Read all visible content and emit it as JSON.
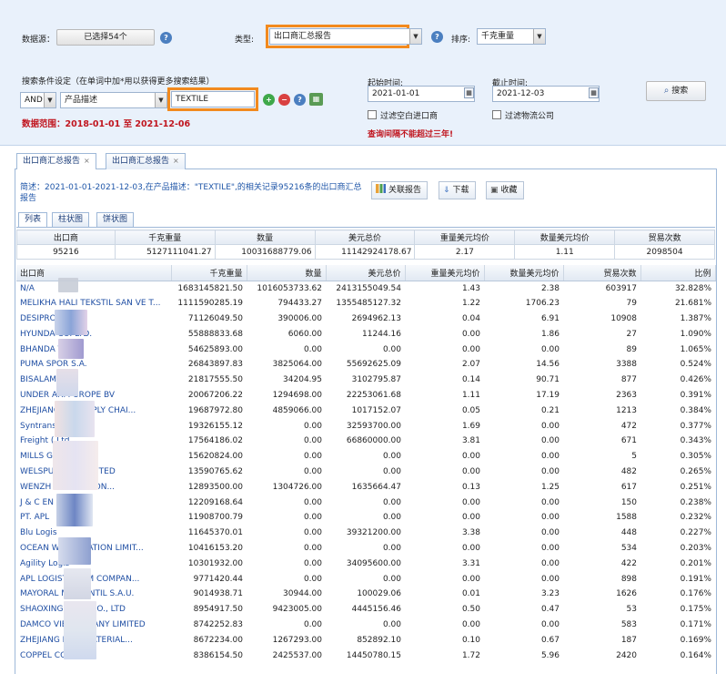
{
  "filters": {
    "datasource_label": "数据源：",
    "datasource_value": "已选择54个",
    "type_label": "类型:",
    "type_value": "出口商汇总报告",
    "sort_label": "排序:",
    "sort_value": "千克重量",
    "condition_label": "搜索条件设定（在单词中加*用以获得更多搜索结果）",
    "logic_value": "AND",
    "field_value": "产品描述",
    "keyword_value": "TEXTILE",
    "range_text": "数据范围：2018-01-01 至 2021-12-06",
    "start_label": "起始时间:",
    "start_value": "2021-01-01",
    "end_label": "截止时间:",
    "end_value": "2021-12-03",
    "filter_empty_label": "过滤空白进口商",
    "filter_logistics_label": "过滤物流公司",
    "warn_text": "查询间隔不能超过三年!",
    "search_label": "搜索"
  },
  "tabs": [
    {
      "label": "出口商汇总报告"
    },
    {
      "label": "出口商汇总报告"
    }
  ],
  "summary": {
    "text": "简述：2021-01-01-2021-12-03,在产品描述：\"TEXTILE\",的相关记录95216条的出口商汇总报告",
    "related_label": "关联报告",
    "download_label": "下载",
    "save_label": "收藏"
  },
  "view_tabs": [
    {
      "label": "列表"
    },
    {
      "label": "柱状图"
    },
    {
      "label": "饼状图"
    }
  ],
  "summary_table": {
    "headers": [
      "出口商",
      "千克重量",
      "数量",
      "美元总价",
      "重量美元均价",
      "数量美元均价",
      "贸易次数"
    ],
    "values": [
      "95216",
      "5127111041.27",
      "10031688779.06",
      "11142924178.67",
      "2.17",
      "1.11",
      "2098504"
    ]
  },
  "table": {
    "headers": [
      "出口商",
      "千克重量",
      "数量",
      "美元总价",
      "重量美元均价",
      "数量美元均价",
      "贸易次数",
      "比例"
    ],
    "rows": [
      [
        "N/A",
        "1683145821.50",
        "1016053733.62",
        "2413155049.54",
        "1.43",
        "2.38",
        "603917",
        "32.828%"
      ],
      [
        "MELIKHA  HALI TEKSTIL SAN VE T...",
        "1111590285.19",
        "794433.27",
        "1355485127.32",
        "1.22",
        "1706.23",
        "79",
        "21.681%"
      ],
      [
        "DESIPRO      LTD.",
        "71126049.50",
        "390006.00",
        "2694962.13",
        "0.04",
        "6.91",
        "10908",
        "1.387%"
      ],
      [
        "HYUNDA        CO. LTD.",
        "55888833.68",
        "6060.00",
        "11244.16",
        "0.00",
        "1.86",
        "27",
        "1.090%"
      ],
      [
        "BHANDA          TS",
        "54625893.00",
        "0.00",
        "0.00",
        "0.00",
        "0.00",
        "89",
        "1.065%"
      ],
      [
        "PUMA SPOR        S.A.",
        "26843897.83",
        "3825064.00",
        "55692625.09",
        "2.07",
        "14.56",
        "3388",
        "0.524%"
      ],
      [
        "BISALAMA L",
        "21817555.50",
        "34204.95",
        "3102795.87",
        "0.14",
        "90.71",
        "877",
        "0.426%"
      ],
      [
        "UNDER ARM    UROPE BV",
        "20067206.22",
        "1294698.00",
        "22253061.68",
        "1.11",
        "17.19",
        "2363",
        "0.391%"
      ],
      [
        "ZHEJIANG        CE SUPPLY CHAI...",
        "19687972.80",
        "4859066.00",
        "1017152.07",
        "0.05",
        "0.21",
        "1213",
        "0.384%"
      ],
      [
        "Syntrans",
        "19326155.12",
        "0.00",
        "32593700.00",
        "1.69",
        "0.00",
        "472",
        "0.377%"
      ],
      [
        "Freight (          Ltd.",
        "17564186.02",
        "0.00",
        "66860000.00",
        "3.81",
        "0.00",
        "671",
        "0.343%"
      ],
      [
        "MILLS G        TILE LTD",
        "15620824.00",
        "0.00",
        "0.00",
        "0.00",
        "0.00",
        "5",
        "0.305%"
      ],
      [
        "WELSPU           ANDS LIMITED",
        "13590765.62",
        "0.00",
        "0.00",
        "0.00",
        "0.00",
        "482",
        "0.265%"
      ],
      [
        "WENZH             NTERNATION...",
        "12893500.00",
        "1304726.00",
        "1635664.47",
        "0.13",
        "1.25",
        "617",
        "0.251%"
      ],
      [
        "J & C EN          MITED",
        "12209168.64",
        "0.00",
        "0.00",
        "0.00",
        "0.00",
        "150",
        "0.238%"
      ],
      [
        "PT. APL",
        "11908700.79",
        "0.00",
        "0.00",
        "0.00",
        "0.00",
        "1588",
        "0.232%"
      ],
      [
        "Blu Logis",
        "11645370.01",
        "0.00",
        "39321200.00",
        "3.38",
        "0.00",
        "448",
        "0.227%"
      ],
      [
        "OCEAN WIN       PORATION LIMIT...",
        "10416153.20",
        "0.00",
        "0.00",
        "0.00",
        "0.00",
        "534",
        "0.203%"
      ],
      [
        "Agility Logis",
        "10301932.00",
        "0.00",
        "34095600.00",
        "3.31",
        "0.00",
        "422",
        "0.201%"
      ],
      [
        "APL LOGIST        TNAM COMPAN...",
        "9771420.44",
        "0.00",
        "0.00",
        "0.00",
        "0.00",
        "898",
        "0.191%"
      ],
      [
        "MAYORAL M        INFANTIL S.A.U.",
        "9014938.71",
        "30944.00",
        "100029.06",
        "0.01",
        "3.23",
        "1626",
        "0.176%"
      ],
      [
        "SHAOXING        XTILE CO., LTD",
        "8954917.50",
        "9423005.00",
        "4445156.46",
        "0.50",
        "0.47",
        "53",
        "0.175%"
      ],
      [
        "DAMCO VIE        COMPANY LIMITED",
        "8742252.83",
        "0.00",
        "0.00",
        "0.00",
        "0.00",
        "583",
        "0.171%"
      ],
      [
        "ZHEJIANG        NEW MATERIAL...",
        "8672234.00",
        "1267293.00",
        "852892.10",
        "0.10",
        "0.67",
        "187",
        "0.169%"
      ],
      [
        "COPPEL CO         ION",
        "8386154.50",
        "2425537.00",
        "14450780.15",
        "1.72",
        "5.96",
        "2420",
        "0.164%"
      ]
    ]
  },
  "colors": {
    "highlight_border": "#f28a1e",
    "header_bg": "#e9f1fb",
    "link_blue": "#1f4ea3",
    "warn_red": "#c0151e"
  }
}
